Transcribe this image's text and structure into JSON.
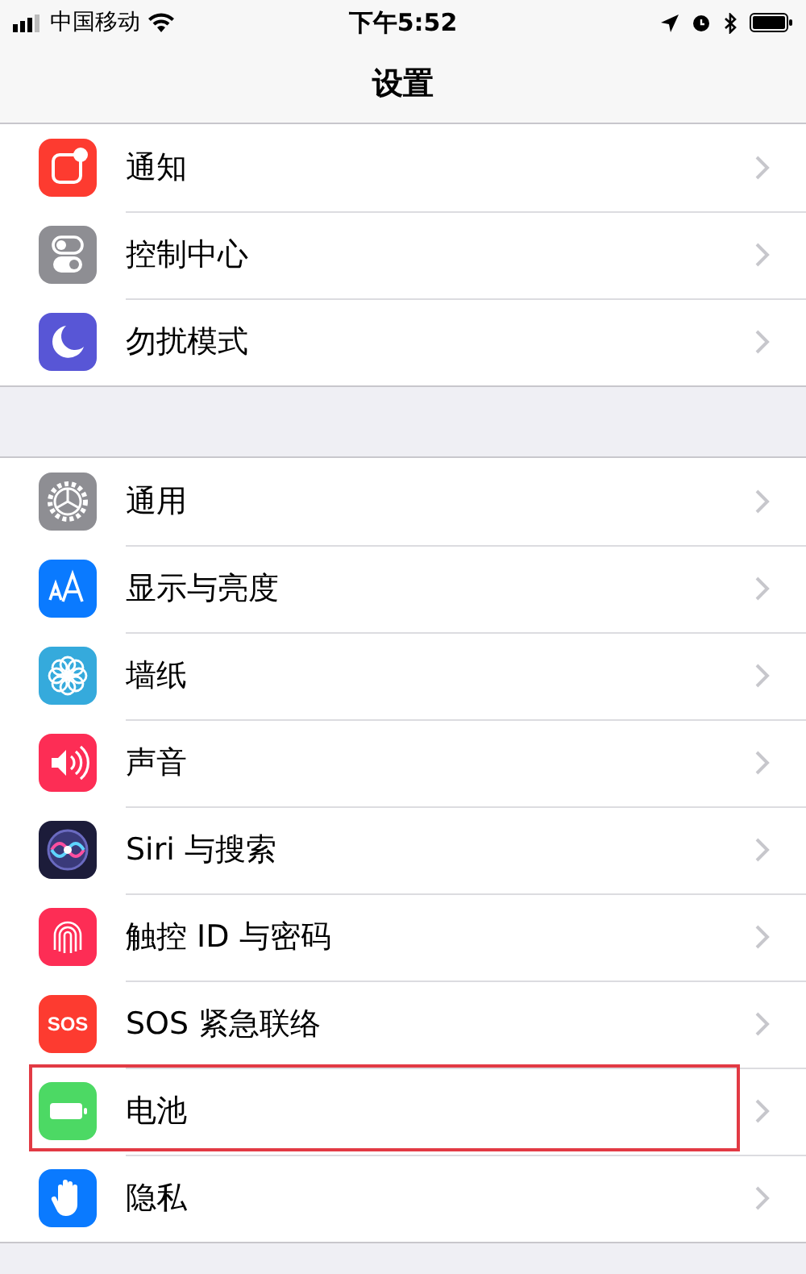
{
  "status_bar": {
    "carrier": "中国移动",
    "time": "下午5:52"
  },
  "nav": {
    "title": "设置"
  },
  "groups": [
    {
      "items": [
        {
          "label": "通知",
          "kind": "notifications",
          "color": "#fd3b30",
          "highlighted": false
        },
        {
          "label": "控制中心",
          "kind": "toggles",
          "color": "#8e8e93",
          "highlighted": false
        },
        {
          "label": "勿扰模式",
          "kind": "moon",
          "color": "#5856d6",
          "highlighted": false
        }
      ]
    },
    {
      "items": [
        {
          "label": "通用",
          "kind": "gear",
          "color": "#8e8e93",
          "highlighted": false
        },
        {
          "label": "显示与亮度",
          "kind": "textsize",
          "color": "#0a7aff",
          "highlighted": false
        },
        {
          "label": "墙纸",
          "kind": "flower",
          "color": "#35aadc",
          "highlighted": false
        },
        {
          "label": "声音",
          "kind": "speaker",
          "color": "#fd2d55",
          "highlighted": false
        },
        {
          "label": "Siri 与搜索",
          "kind": "siri",
          "color": "#1c1c3a",
          "highlighted": false
        },
        {
          "label": "触控 ID 与密码",
          "kind": "fingerprint",
          "color": "#fd2d55",
          "highlighted": false
        },
        {
          "label": "SOS 紧急联络",
          "kind": "sos",
          "icon_text": "SOS",
          "color": "#fd3b30",
          "highlighted": false
        },
        {
          "label": "电池",
          "kind": "battery",
          "color": "#4cd964",
          "highlighted": true
        },
        {
          "label": "隐私",
          "kind": "hand",
          "color": "#0a7aff",
          "highlighted": false
        }
      ]
    }
  ]
}
